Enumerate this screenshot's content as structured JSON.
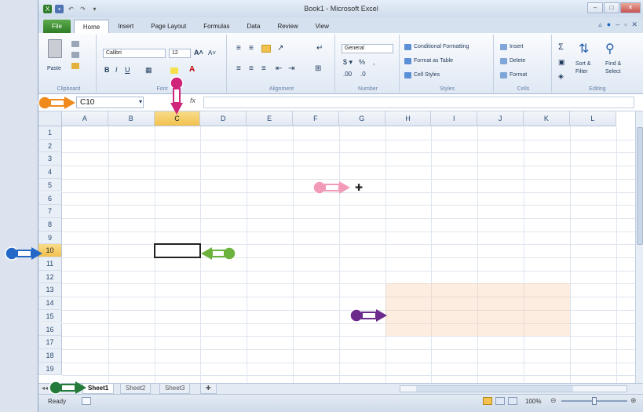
{
  "window": {
    "title": "Book1 - Microsoft Excel"
  },
  "tabs": [
    "File",
    "Home",
    "Insert",
    "Page Layout",
    "Formulas",
    "Data",
    "Review",
    "View"
  ],
  "ribbon": {
    "clipboard": {
      "label": "Clipboard",
      "paste": "Paste"
    },
    "font": {
      "label": "Font",
      "name": "Calibri",
      "size": "12"
    },
    "alignment": {
      "label": "Alignment"
    },
    "number": {
      "label": "Number",
      "format": "General"
    },
    "styles": {
      "label": "Styles",
      "conditional": "Conditional Formatting",
      "table": "Format as Table",
      "cell": "Cell Styles"
    },
    "cells": {
      "label": "Cells",
      "insert": "Insert",
      "delete": "Delete",
      "format": "Format"
    },
    "editing": {
      "label": "Editing",
      "sort": "Sort &",
      "sort2": "Filter",
      "find": "Find &",
      "find2": "Select"
    }
  },
  "formula_bar": {
    "name_box": "C10",
    "fx": "fx"
  },
  "columns": [
    "A",
    "B",
    "C",
    "D",
    "E",
    "F",
    "G",
    "H",
    "I",
    "J",
    "K",
    "L"
  ],
  "rows": [
    "1",
    "2",
    "3",
    "4",
    "5",
    "6",
    "7",
    "8",
    "9",
    "10",
    "11",
    "12",
    "13",
    "14",
    "15",
    "16",
    "17",
    "18",
    "19"
  ],
  "active_cell": "C10",
  "sheets": [
    "Sheet1",
    "Sheet2",
    "Sheet3"
  ],
  "status": {
    "ready": "Ready",
    "zoom": "100%"
  },
  "colors": {
    "orange": "#f08a1c",
    "magenta": "#d0247a",
    "pink": "#f29bb8",
    "blue": "#2468c8",
    "green": "#6cb33e",
    "purple": "#6b2a8c",
    "darkgreen": "#237a3a"
  }
}
